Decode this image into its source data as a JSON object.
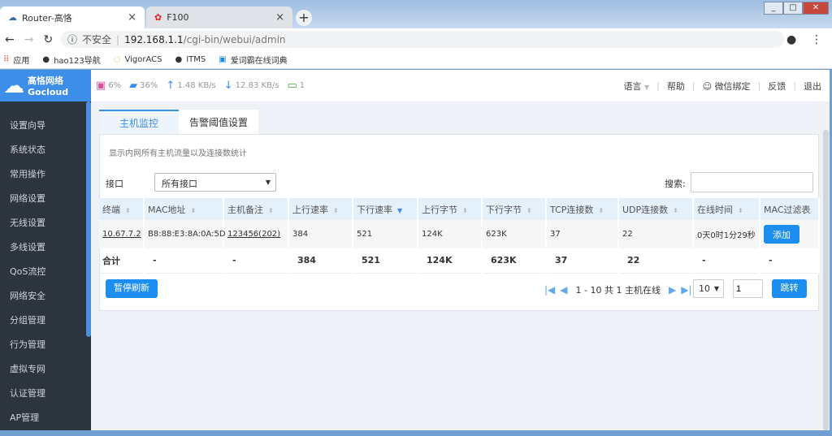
{
  "browser": {
    "tabs": [
      {
        "title": "Router-高恪"
      },
      {
        "title": "F100"
      }
    ],
    "url_prefix": "不安全",
    "url_host": "192.168.1.1",
    "url_path": "/cgi-bin/webui/admin",
    "bookmarks": [
      "应用",
      "hao123导航",
      "VigorACS",
      "ITMS",
      "爱词霸在线词典"
    ]
  },
  "header": {
    "logo_cn": "高恪网络",
    "logo_en": "Gocloud",
    "cpu": "6%",
    "mem": "36%",
    "up": "1.48 KB/s",
    "down": "12.83 KB/s",
    "online": "1",
    "links": [
      "语言",
      "帮助",
      "微信绑定",
      "反馈",
      "退出"
    ]
  },
  "sidebar": {
    "items": [
      "设置向导",
      "系统状态",
      "常用操作",
      "网络设置",
      "无线设置",
      "多线设置",
      "QoS流控",
      "网络安全",
      "分组管理",
      "行为管理",
      "虚拟专网",
      "认证管理",
      "AP管理"
    ]
  },
  "tabs": [
    "主机监控",
    "告警阈值设置"
  ],
  "panel": {
    "description": "显示内网所有主机流量以及连接数统计",
    "interface_label": "接口",
    "interface_value": "所有接口",
    "search_label": "搜索:",
    "search_value": ""
  },
  "table": {
    "columns": [
      "终端",
      "MAC地址",
      "主机备注",
      "上行速率",
      "下行速率",
      "上行字节",
      "下行字节",
      "TCP连接数",
      "UDP连接数",
      "在线时间",
      "MAC过滤表"
    ],
    "rows": [
      [
        "10.67.7.2",
        "B8:88:E3:8A:0A:5D",
        "123456(202)",
        "384",
        "521",
        "124K",
        "623K",
        "37",
        "22",
        "0天0时1分29秒",
        "添加"
      ]
    ],
    "total": [
      "合计",
      "-",
      "-",
      "384",
      "521",
      "124K",
      "623K",
      "37",
      "22",
      "-",
      "-"
    ]
  },
  "footer": {
    "pause_label": "暂停刷新",
    "pager_text": "1 - 10 共 1 主机在线",
    "page_size": "10",
    "page_input": "1",
    "jump_label": "跳转"
  }
}
